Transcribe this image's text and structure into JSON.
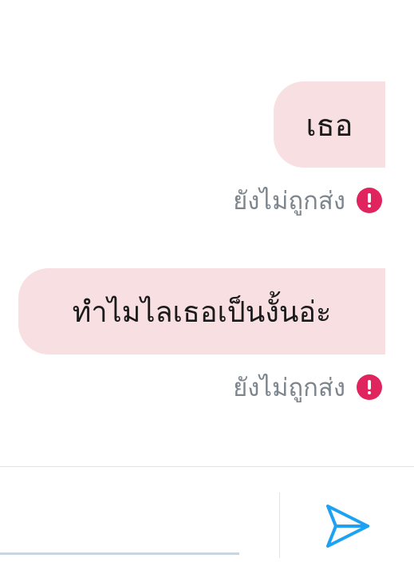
{
  "messages": [
    {
      "text": "เธอ",
      "status": "ยังไม่ถูกส่ง"
    },
    {
      "text": "ทำไมไลเธอเป็นงั้นอ่ะ",
      "status": "ยังไม่ถูกส่ง"
    }
  ],
  "composer": {
    "input_value": "",
    "send_icon": "send-icon"
  },
  "colors": {
    "bubble_bg": "#f7dfe2",
    "status_text": "#7d858d",
    "error_icon": "#e0245e",
    "send_icon": "#1da1f2"
  }
}
